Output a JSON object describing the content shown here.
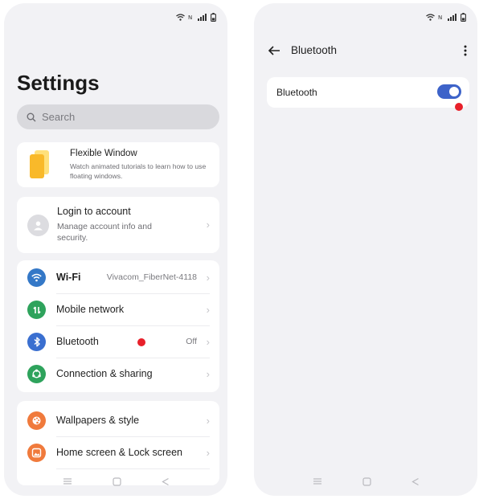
{
  "status_bar": {
    "icons": [
      "wifi-icon",
      "data-icon",
      "signal-icon",
      "battery-icon"
    ]
  },
  "settings": {
    "title": "Settings",
    "search_placeholder": "Search",
    "flexible_window": {
      "title": "Flexible Window",
      "description": "Watch animated tutorials to learn how to use floating windows."
    },
    "account": {
      "title": "Login to account",
      "description": "Manage account info and security."
    },
    "network_items": [
      {
        "label": "Wi-Fi",
        "value": "Vivacom_FiberNet-4118",
        "icon": "wifi-icon",
        "color": "#3478c7"
      },
      {
        "label": "Mobile network",
        "value": "",
        "icon": "mobile-network-icon",
        "color": "#2ea35c"
      },
      {
        "label": "Bluetooth",
        "value": "Off",
        "icon": "bluetooth-icon",
        "color": "#3a6fd0"
      },
      {
        "label": "Connection & sharing",
        "value": "",
        "icon": "connection-sharing-icon",
        "color": "#2ea35c"
      }
    ],
    "personalization_items": [
      {
        "label": "Wallpapers & style",
        "icon": "palette-icon",
        "color": "#f07a3c"
      },
      {
        "label": "Home screen & Lock screen",
        "icon": "home-screen-icon",
        "color": "#f07a3c"
      }
    ]
  },
  "bluetooth_screen": {
    "title": "Bluetooth",
    "toggle_label": "Bluetooth",
    "toggle_on": true
  },
  "colors": {
    "accent": "#3d63c9",
    "highlight_dot": "#e8202a",
    "background": "#f2f2f5"
  }
}
